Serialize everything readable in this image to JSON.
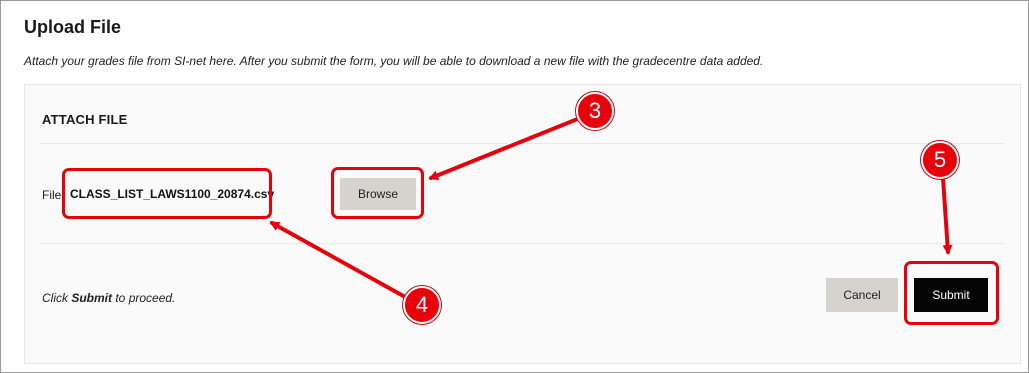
{
  "page": {
    "title": "Upload File",
    "intro": "Attach your grades file from SI-net here. After you submit the form, you will be able to download a new file with the gradecentre data added."
  },
  "attach": {
    "section_title": "ATTACH FILE",
    "file_label": "File:",
    "file_name": "CLASS_LIST_LAWS1100_20874.csv",
    "browse_label": "Browse"
  },
  "actions": {
    "proceed_prefix": "Click ",
    "proceed_bold": "Submit",
    "proceed_suffix": " to proceed.",
    "cancel_label": "Cancel",
    "submit_label": "Submit"
  },
  "annotations": {
    "callout_3": "3",
    "callout_4": "4",
    "callout_5": "5",
    "color": "#e8000b"
  }
}
